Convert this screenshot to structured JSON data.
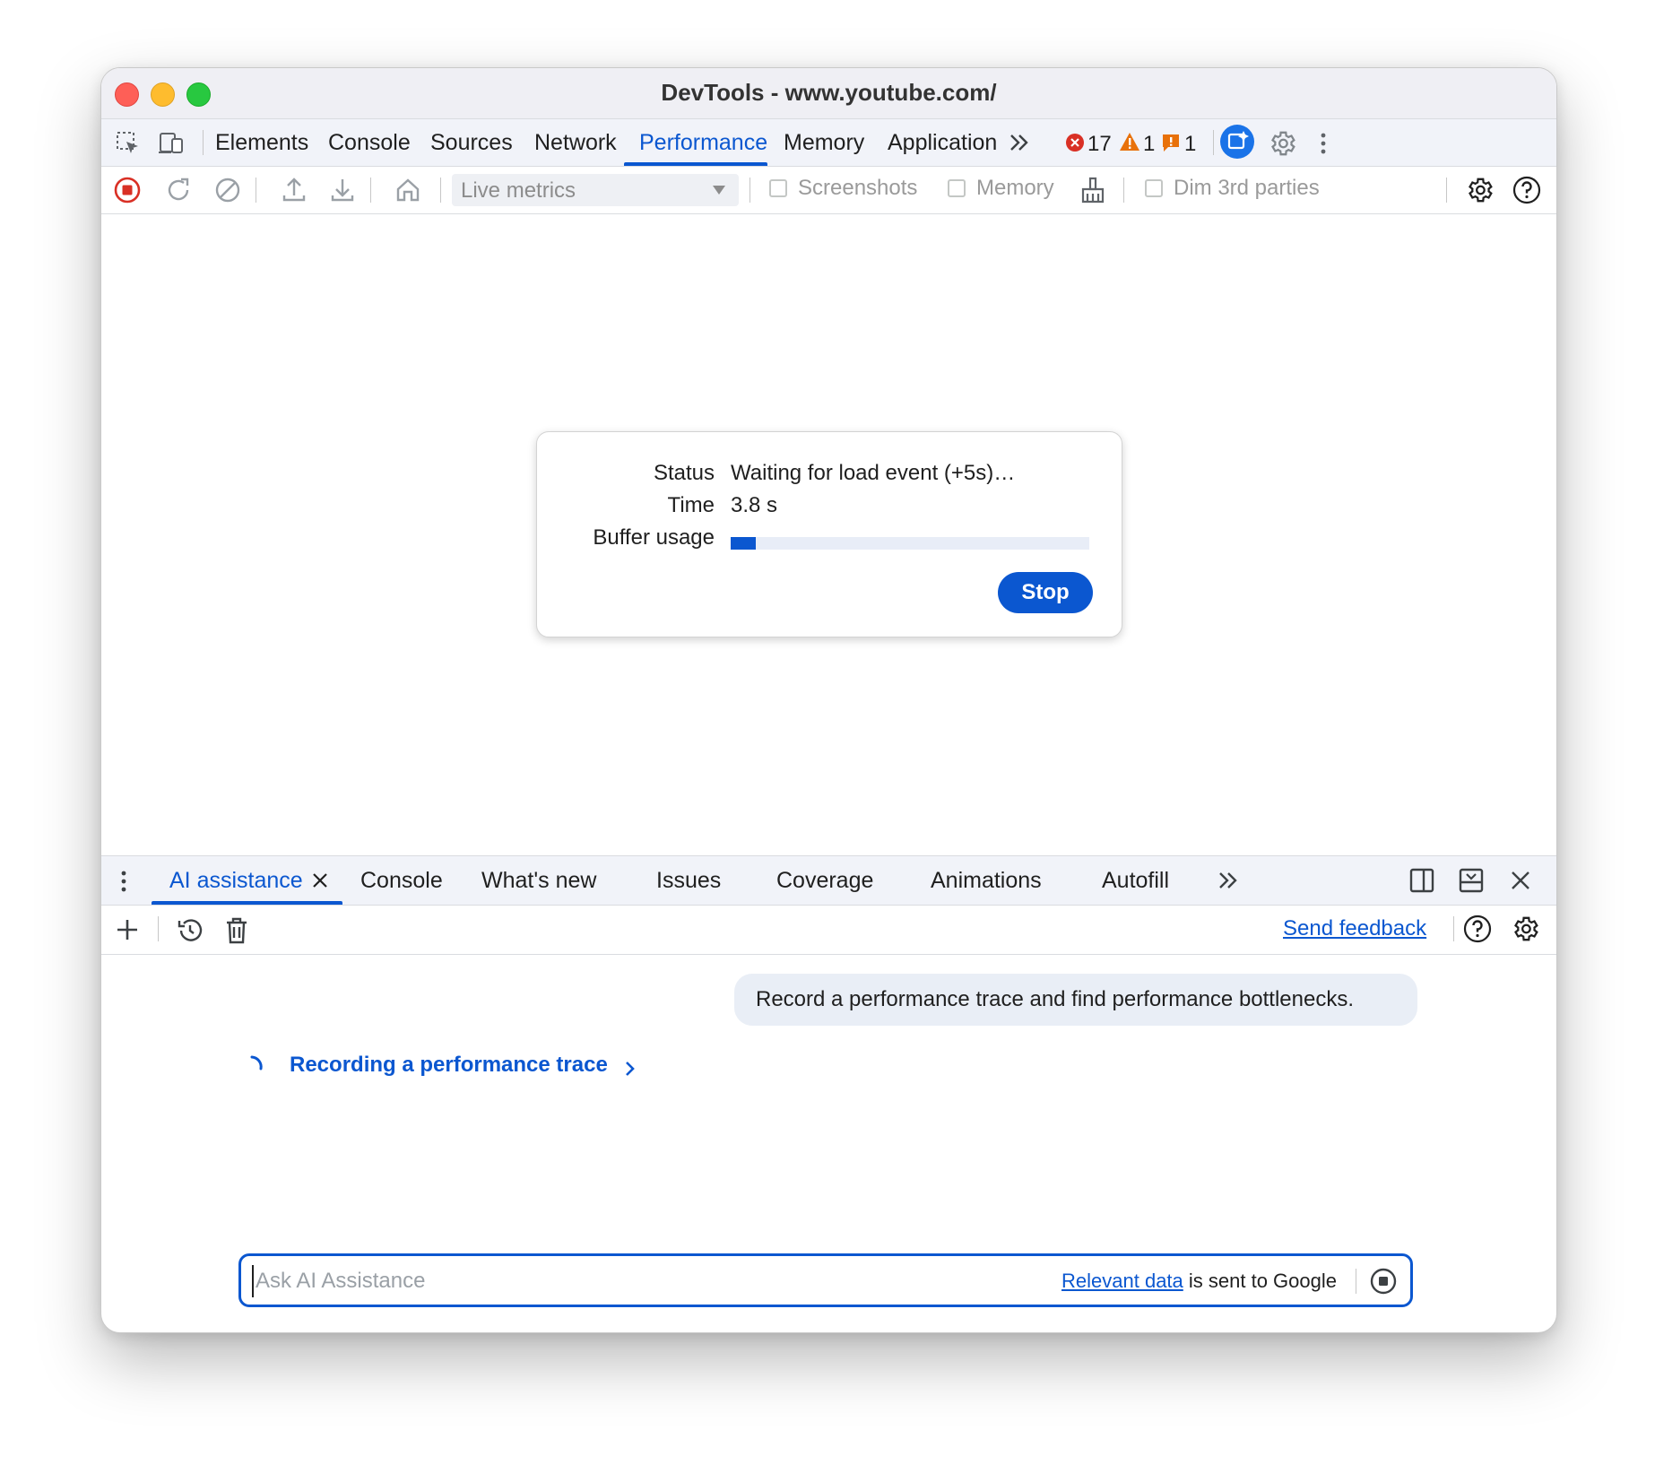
{
  "window": {
    "title": "DevTools - www.youtube.com/"
  },
  "main_tabs": {
    "items": [
      "Elements",
      "Console",
      "Sources",
      "Network",
      "Performance",
      "Memory",
      "Application"
    ],
    "active": "Performance",
    "more_icon": "chevron-double-right-icon"
  },
  "counters": {
    "errors": "17",
    "warnings": "1",
    "issues": "1"
  },
  "toolbar": {
    "select_value": "Live metrics",
    "checkboxes": [
      "Screenshots",
      "Memory",
      "Dim 3rd parties"
    ]
  },
  "recording": {
    "status_label": "Status",
    "status_value": "Waiting for load event (+5s)…",
    "time_label": "Time",
    "time_value": "3.8 s",
    "buffer_label": "Buffer usage",
    "buffer_fraction": 0.07,
    "stop_label": "Stop"
  },
  "drawer": {
    "tabs": [
      "AI assistance",
      "Console",
      "What's new",
      "Issues",
      "Coverage",
      "Animations",
      "Autofill"
    ],
    "active": "AI assistance",
    "send_feedback": "Send feedback"
  },
  "chat": {
    "user_message": "Record a performance trace and find performance bottlenecks.",
    "step_label": "Recording a performance trace",
    "input_placeholder": "Ask AI Assistance",
    "disclaimer_link": "Relevant data",
    "disclaimer_text": " is sent to Google"
  },
  "colors": {
    "accent": "#0b57d0",
    "record_red": "#d93025",
    "warning": "#e8710a",
    "error": "#d93025"
  }
}
